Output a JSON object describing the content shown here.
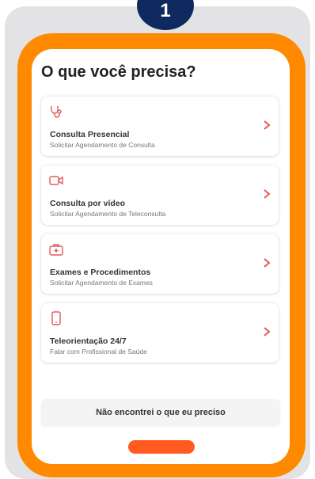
{
  "step": {
    "number": "1"
  },
  "screen": {
    "title": "O que você precisa?",
    "options": [
      {
        "icon": "stethoscope-icon",
        "title": "Consulta Presencial",
        "subtitle": "Solicitar Agendamento de Consulta"
      },
      {
        "icon": "video-camera-icon",
        "title": "Consulta por vídeo",
        "subtitle": "Solicitar Agendamento de Teleconsulta"
      },
      {
        "icon": "medical-kit-icon",
        "title": "Exames e Procedimentos",
        "subtitle": "Solicitar Agendamento de Exames"
      },
      {
        "icon": "smartphone-icon",
        "title": "Teleorientação 24/7",
        "subtitle": "Falar com Profissional de Saúde"
      }
    ],
    "not_found_label": "Não encontrei o que eu preciso"
  },
  "colors": {
    "frame": "#ff8a00",
    "badge": "#0f2a5e",
    "accent": "#e05a5a",
    "pill": "#ff5a1f",
    "background": "#e3e3e6"
  }
}
